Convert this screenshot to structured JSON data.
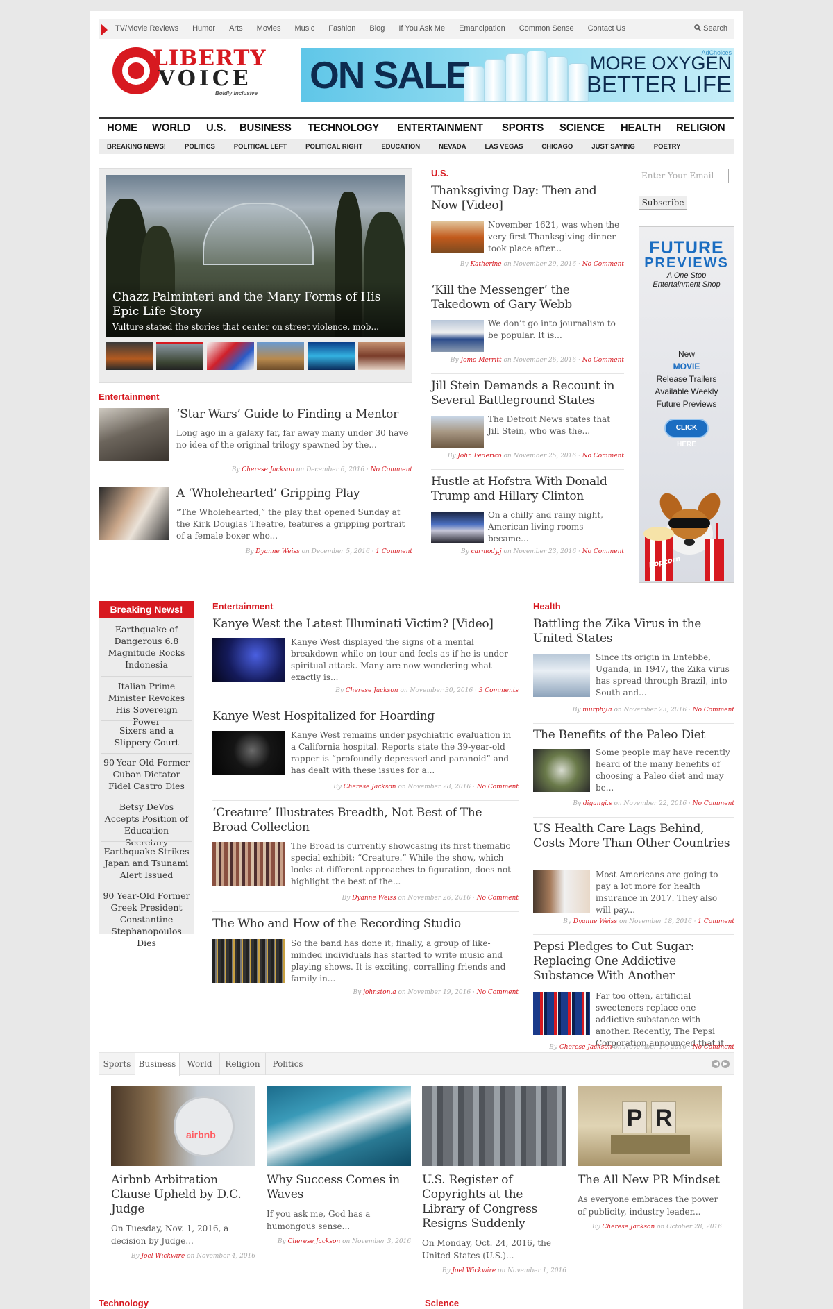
{
  "top_nav": {
    "items": [
      "TV/Movie Reviews",
      "Humor",
      "Arts",
      "Movies",
      "Music",
      "Fashion",
      "Blog",
      "If You Ask Me",
      "Emancipation",
      "Common Sense",
      "Contact Us"
    ],
    "search_label": "Search"
  },
  "logo": {
    "word1": "LIBERTY",
    "word2": "VOICE",
    "tagline": "Boldly Inclusive"
  },
  "banner_ad": {
    "left_text": "ON SALE",
    "right_line1": "MORE OXYGEN",
    "right_line2": "BETTER LIFE",
    "adchoices": "AdChoices"
  },
  "main_nav": [
    "HOME",
    "WORLD",
    "U.S.",
    "BUSINESS",
    "TECHNOLOGY",
    "ENTERTAINMENT",
    "SPORTS",
    "SCIENCE",
    "HEALTH",
    "RELIGION"
  ],
  "sub_nav": [
    "BREAKING NEWS!",
    "POLITICS",
    "POLITICAL LEFT",
    "POLITICAL RIGHT",
    "EDUCATION",
    "NEVADA",
    "LAS VEGAS",
    "CHICAGO",
    "JUST SAYING",
    "POETRY"
  ],
  "slider": {
    "title": "Chazz Palminteri and the Many Forms of His Epic Life Story",
    "excerpt": "Vulture stated the stories that center on street violence, mob..."
  },
  "entertainment_top": {
    "heading": "Entertainment",
    "articles": [
      {
        "title": "‘Star Wars’ Guide to Finding a Mentor",
        "excerpt": "Long ago in a galaxy far, far away many under 30 have no idea of the original trilogy spawned by the...",
        "by": "By",
        "author": "Cherese Jackson",
        "date": "on December 6, 2016",
        "comments": "No Comment"
      },
      {
        "title": "A ‘Wholehearted’ Gripping Play",
        "excerpt": "“The Wholehearted,” the play that opened Sunday at the Kirk Douglas Theatre, features a gripping portrait of a female boxer who...",
        "by": "By",
        "author": "Dyanne Weiss",
        "date": "on December 5, 2016",
        "comments": "1 Comment"
      }
    ]
  },
  "us_section": {
    "heading": "U.S.",
    "articles": [
      {
        "title": "Thanksgiving Day: Then and Now [Video]",
        "excerpt": "November 1621, was when the very first Thanksgiving dinner took place after...",
        "by": "By",
        "author": "Katherine",
        "date": "on November 29, 2016",
        "comments": "No Comment"
      },
      {
        "title": "‘Kill the Messenger’ the Takedown of Gary Webb",
        "excerpt": "We don’t go into journalism to be popular. It is...",
        "by": "By",
        "author": "Jomo Merritt",
        "date": "on November 26, 2016",
        "comments": "No Comment"
      },
      {
        "title": "Jill Stein Demands a Recount in Several Battleground States",
        "excerpt": "The Detroit News states that Jill Stein, who was the...",
        "by": "By",
        "author": "John Federico",
        "date": "on November 25, 2016",
        "comments": "No Comment"
      },
      {
        "title": "Hustle at Hofstra With Donald Trump and Hillary Clinton",
        "excerpt": "On a chilly and rainy night, American living rooms became...",
        "by": "By",
        "author": "carmody.j",
        "date": "on November 23, 2016",
        "comments": "No Comment"
      }
    ]
  },
  "sidebar": {
    "email_placeholder": "Enter Your Email",
    "subscribe_label": "Subscribe",
    "ad": {
      "line1": "FUTURE",
      "line2": "PREVIEWS",
      "tagline1": "A One Stop",
      "tagline2": "Entertainment Shop",
      "text1": "New",
      "text2": "MOVIE",
      "text3": "Release Trailers",
      "text4": "Available Weekly",
      "text5": "Future Previews",
      "button": "CLICK HERE",
      "popcorn": "Popcorn"
    }
  },
  "breaking_news": {
    "heading": "Breaking News!",
    "items": [
      "Earthquake of Dangerous 6.8 Magnitude Rocks Indonesia",
      "Italian Prime Minister Revokes His Sovereign Power",
      "Sixers and a Slippery Court",
      "90-Year-Old Former Cuban Dictator Fidel Castro Dies",
      "Betsy DeVos Accepts Position of Education Secretary",
      "Earthquake Strikes Japan and Tsunami Alert Issued",
      "90 Year-Old Former Greek President Constantine Stephanopoulos Dies"
    ]
  },
  "entertainment_mid": {
    "heading": "Entertainment",
    "articles": [
      {
        "title": "Kanye West the Latest Illuminati Victim? [Video]",
        "excerpt": "Kanye West displayed the signs of a mental breakdown while on tour and feels as if he is under spiritual attack. Many are now wondering what exactly is...",
        "by": "By",
        "author": "Cherese Jackson",
        "date": "on November 30, 2016",
        "comments": "3 Comments"
      },
      {
        "title": "Kanye West Hospitalized for Hoarding",
        "excerpt": "Kanye West remains under psychiatric evaluation in a California hospital. Reports state the 39-year-old rapper is “profoundly depressed and paranoid” and has dealt with these issues for a...",
        "by": "By",
        "author": "Cherese Jackson",
        "date": "on November 28, 2016",
        "comments": "No Comment"
      },
      {
        "title": "‘Creature’ Illustrates Breadth, Not Best of The Broad Collection",
        "excerpt": "The Broad is currently showcasing its first thematic special exhibit: “Creature.” While the show, which looks at different approaches to figuration, does not highlight the best of the...",
        "by": "By",
        "author": "Dyanne Weiss",
        "date": "on November 26, 2016",
        "comments": "No Comment"
      },
      {
        "title": "The Who and How of the Recording Studio",
        "excerpt": "So the band has done it; finally, a group of like-minded individuals has started to write music and playing shows. It is exciting, corralling friends and family in...",
        "by": "By",
        "author": "johnston.a",
        "date": "on November 19, 2016",
        "comments": "No Comment"
      }
    ]
  },
  "health": {
    "heading": "Health",
    "articles": [
      {
        "title": "Battling the Zika Virus in the United States",
        "excerpt": "Since its origin in Entebbe, Uganda, in 1947, the Zika virus has spread through Brazil, into South and...",
        "by": "By",
        "author": "murphy.a",
        "date": "on November 23, 2016",
        "comments": "No Comment"
      },
      {
        "title": "The Benefits of the Paleo Diet",
        "excerpt": "Some people may have recently heard of the many benefits of choosing a Paleo diet and may be...",
        "by": "By",
        "author": "digangi.s",
        "date": "on November 22, 2016",
        "comments": "No Comment"
      },
      {
        "title": "US Health Care Lags Behind, Costs More Than Other Countries",
        "excerpt": "Most Americans are going to pay a lot more for health insurance in 2017. They also will pay...",
        "by": "By",
        "author": "Dyanne Weiss",
        "date": "on November 18, 2016",
        "comments": "1 Comment"
      },
      {
        "title": "Pepsi Pledges to Cut Sugar: Replacing One Addictive Substance With Another",
        "excerpt": "Far too often, artificial sweeteners replace one addictive substance with another. Recently, The Pepsi Corporation announced that it...",
        "by": "By",
        "author": "Cherese Jackson",
        "date": "on November 17, 2016",
        "comments": "No Comment"
      }
    ]
  },
  "tab_box": {
    "tabs": [
      "Sports",
      "Business",
      "World",
      "Religion",
      "Politics"
    ],
    "active_tab": "Business",
    "cards": [
      {
        "title": "Airbnb Arbitration Clause Upheld by D.C. Judge",
        "excerpt": "On Tuesday, Nov. 1, 2016, a decision by Judge...",
        "by": "By",
        "author": "Joel Wickwire",
        "date": "on November 4, 2016",
        "sign": "airbnb"
      },
      {
        "title": "Why Success Comes in Waves",
        "excerpt": "If you ask me, God has a humongous sense...",
        "by": "By",
        "author": "Cherese Jackson",
        "date": "on November 3, 2016"
      },
      {
        "title": "U.S. Register of Copyrights at the Library of Congress Resigns Suddenly",
        "excerpt": "On Monday, Oct. 24, 2016, the United States (U.S.)...",
        "by": "By",
        "author": "Joel Wickwire",
        "date": "on November 1, 2016"
      },
      {
        "title": "The All New PR Mindset",
        "excerpt": "As everyone embraces the power of publicity, industry leader...",
        "by": "By",
        "author": "Cherese Jackson",
        "date": "on October 28, 2016",
        "sign": "PR"
      }
    ]
  },
  "bottom_headings": {
    "left": "Technology",
    "right": "Science"
  },
  "colors": {
    "accent": "#d71920",
    "nav_gray": "#ececec"
  }
}
